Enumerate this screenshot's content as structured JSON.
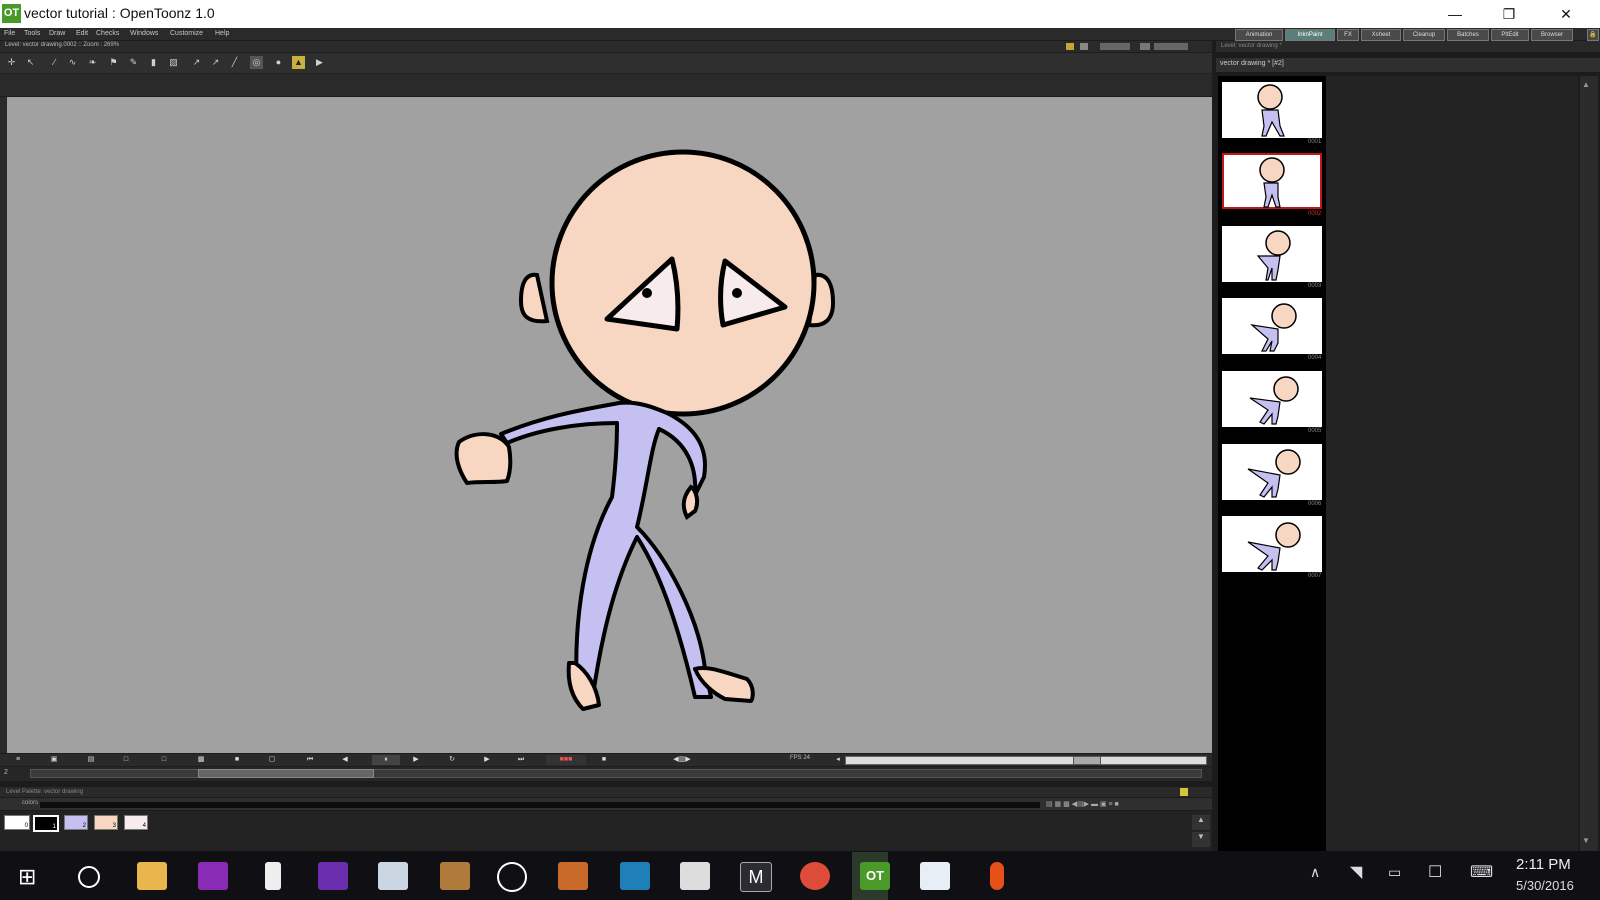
{
  "window": {
    "title": "vector tutorial : OpenToonz 1.0",
    "icon": "OT"
  },
  "menus": [
    "File",
    "Tools",
    "Draw",
    "Edit",
    "Checks",
    "Windows",
    "Customize",
    "Help"
  ],
  "rooms": [
    "Animation",
    "InknPaint",
    "FX",
    "Xsheet",
    "Cleanup",
    "Batches",
    "PltEdit",
    "Browser"
  ],
  "active_room": "InknPaint",
  "viewer": {
    "header": "Level: vector drawing.0002 :: Zoom : 269%"
  },
  "playback": {
    "fps_label": "FPS 24",
    "frame_field": "2"
  },
  "palette": {
    "header": "Level Palette: vector drawing",
    "tab": "colors",
    "swatches": [
      {
        "num": "1",
        "color": "#000000"
      },
      {
        "num": "2",
        "color": "#c4c1f2"
      },
      {
        "num": "3",
        "color": "#f7d7c1"
      },
      {
        "num": "4",
        "color": "#f8ebeb"
      }
    ]
  },
  "level_strip": {
    "header": "Level: vector drawing *",
    "title": "vector drawing * [#2]",
    "frames": [
      "0001",
      "0002",
      "0003",
      "0004",
      "0005",
      "0006",
      "0007"
    ],
    "selected": "0002"
  },
  "taskbar": {
    "time": "2:11 PM",
    "date": "5/30/2016"
  },
  "colors": {
    "skin": "#f7d7c1",
    "suit": "#c4c1f2",
    "eye": "#f8ebeb",
    "canvas": "#a1a1a1"
  }
}
